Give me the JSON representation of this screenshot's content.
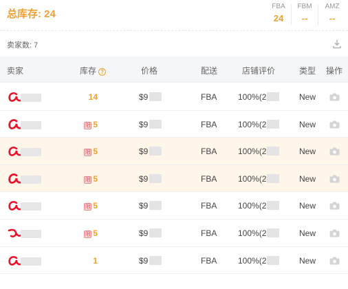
{
  "header": {
    "total_label": "总库存: 24",
    "fulfillment": [
      {
        "label": "FBA",
        "value": "24"
      },
      {
        "label": "FBM",
        "value": "--"
      },
      {
        "label": "AMZ",
        "value": "--"
      }
    ]
  },
  "seller_count": "卖家数: 7",
  "table": {
    "columns": [
      "卖家",
      "库存",
      "价格",
      "配送",
      "店铺评价",
      "类型",
      "操作"
    ],
    "rows": [
      {
        "stock": "14",
        "limited": false,
        "price": "$9",
        "shipping": "FBA",
        "rating": "100%(2",
        "type": "New"
      },
      {
        "stock": "5",
        "limited": true,
        "price": "$9",
        "shipping": "FBA",
        "rating": "100%(2",
        "type": "New"
      },
      {
        "stock": "5",
        "limited": true,
        "price": "$9",
        "shipping": "FBA",
        "rating": "100%(2",
        "type": "New"
      },
      {
        "stock": "5",
        "limited": true,
        "price": "$9",
        "shipping": "FBA",
        "rating": "100%(2",
        "type": "New"
      },
      {
        "stock": "5",
        "limited": true,
        "price": "$9",
        "shipping": "FBA",
        "rating": "100%(2",
        "type": "New"
      },
      {
        "stock": "5",
        "limited": true,
        "price": "$9",
        "shipping": "FBA",
        "rating": "100%(2",
        "type": "New"
      },
      {
        "stock": "1",
        "limited": false,
        "price": "$9",
        "shipping": "FBA",
        "rating": "100%(2",
        "type": "New"
      }
    ]
  },
  "limit_badge_text": "限",
  "help_icon_text": "?",
  "colors": {
    "accent": "#f0a030",
    "highlight_row": "#fef6e9",
    "header_bg": "#f5f6f8",
    "limit_red": "#d9534f"
  },
  "icons": {
    "download": "download-icon",
    "help": "help-icon",
    "action": "camera-icon"
  }
}
